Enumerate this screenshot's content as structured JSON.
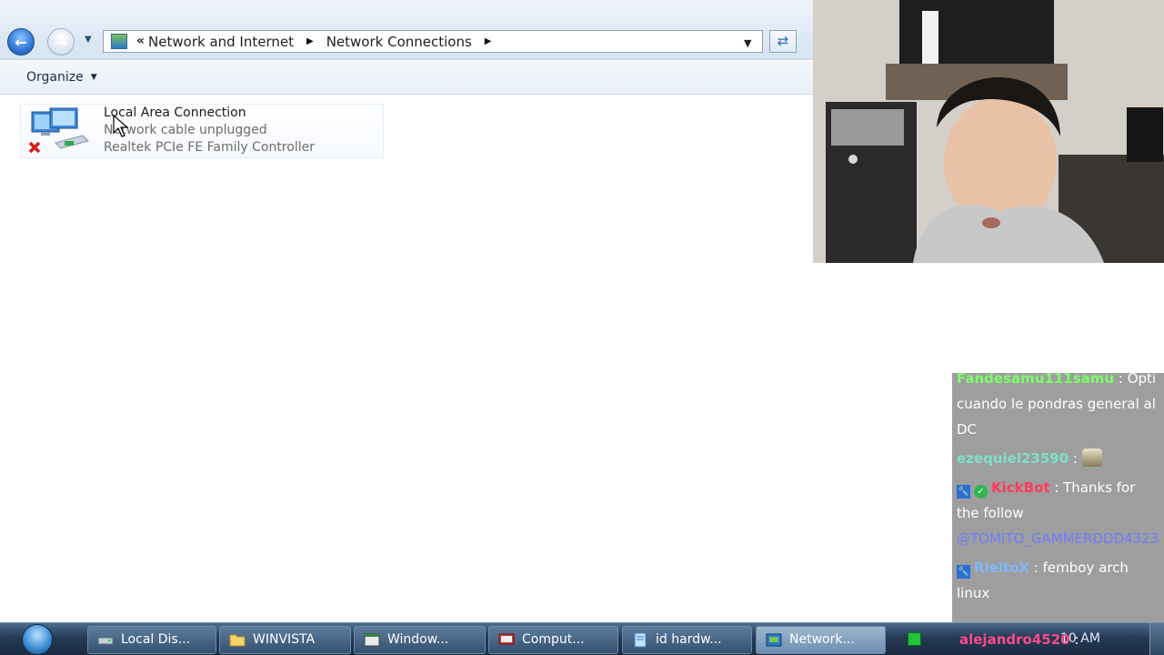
{
  "explorer": {
    "breadcrumb": {
      "lead": "«",
      "items": [
        "Network and Internet",
        "Network Connections"
      ]
    },
    "toolbar": {
      "organize_label": "Organize"
    },
    "connection": {
      "name": "Local Area Connection",
      "status": "Network cable unplugged",
      "device": "Realtek PCIe FE Family Controller"
    }
  },
  "chat": {
    "messages": [
      {
        "user": "Fandesamu111samu",
        "sep": " : ",
        "text": "Opti cuando le pondras general al DC"
      },
      {
        "user": "ezequiel23590",
        "sep": " : ",
        "emote": "emote"
      },
      {
        "user": "KickBot",
        "sep": " : ",
        "text": "Thanks for the follow ",
        "mention": "@TOMITO_GAMMERDDD4323"
      },
      {
        "user": "RieltoX",
        "sep": " : ",
        "text": "femboy arch linux"
      },
      {
        "user": "alejandro4520",
        "sep": " : "
      }
    ]
  },
  "taskbar": {
    "items": [
      {
        "label": "Local Dis...",
        "icon": "drive-icon"
      },
      {
        "label": "WINVISTA",
        "icon": "folder-icon"
      },
      {
        "label": "Window...",
        "icon": "window-icon"
      },
      {
        "label": "Comput...",
        "icon": "computer-icon"
      },
      {
        "label": "id hardw...",
        "icon": "notepad-icon"
      },
      {
        "label": "Network...",
        "icon": "network-icon",
        "active": true
      }
    ],
    "clock": "10 AM"
  }
}
